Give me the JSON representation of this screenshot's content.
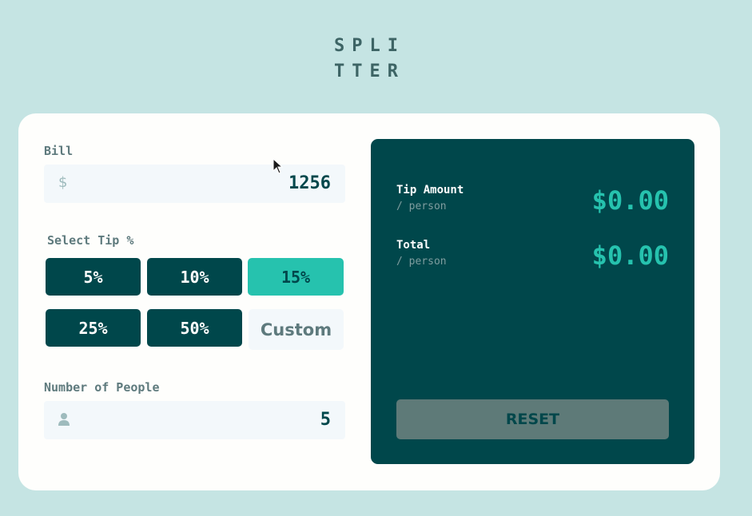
{
  "logo": {
    "line1": "SPLI",
    "line2": "TTER"
  },
  "bill": {
    "label": "Bill",
    "currency_symbol": "$",
    "value": "1256"
  },
  "tip": {
    "label": "Select Tip %",
    "options": [
      "5%",
      "10%",
      "15%",
      "25%",
      "50%"
    ],
    "selected": "15%",
    "custom_placeholder": "Custom"
  },
  "people": {
    "label": "Number of People",
    "value": "5"
  },
  "results": {
    "tip_label": "Tip Amount",
    "tip_sub": "/ person",
    "tip_value": "$0.00",
    "total_label": "Total",
    "total_sub": "/ person",
    "total_value": "$0.00",
    "reset_label": "RESET"
  },
  "colors": {
    "background": "#c5e4e3",
    "dark_teal": "#00474b",
    "accent": "#26c2ae",
    "muted": "#5e7a7d"
  }
}
